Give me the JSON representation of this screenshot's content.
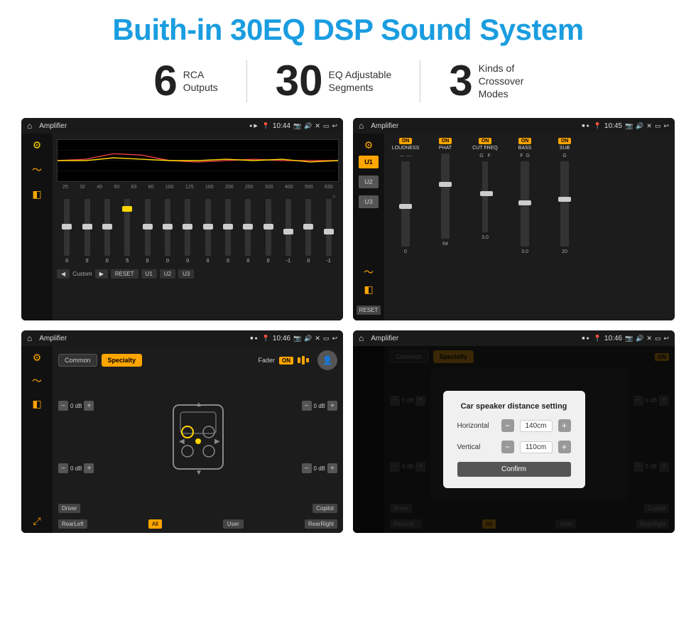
{
  "title": "Buith-in 30EQ DSP Sound System",
  "stats": [
    {
      "number": "6",
      "label": "RCA\nOutputs"
    },
    {
      "number": "30",
      "label": "EQ Adjustable\nSegments"
    },
    {
      "number": "3",
      "label": "Kinds of\nCrossover Modes"
    }
  ],
  "screens": [
    {
      "id": "screen1",
      "status": {
        "time": "10:44",
        "title": "Amplifier"
      },
      "eq_labels": [
        "25",
        "32",
        "40",
        "50",
        "63",
        "80",
        "100",
        "125",
        "160",
        "200",
        "250",
        "320",
        "400",
        "500",
        "630"
      ],
      "eq_values": [
        "0",
        "0",
        "0",
        "5",
        "0",
        "0",
        "0",
        "0",
        "0",
        "0",
        "0",
        "-1",
        "0",
        "-1"
      ],
      "bottom_buttons": [
        "◀",
        "Custom",
        "▶",
        "RESET",
        "U1",
        "U2",
        "U3"
      ]
    },
    {
      "id": "screen2",
      "status": {
        "time": "10:45",
        "title": "Amplifier"
      },
      "presets": [
        "U1",
        "U2",
        "U3"
      ],
      "channels": [
        {
          "name": "LOUDNESS",
          "on": true
        },
        {
          "name": "PHAT",
          "on": true
        },
        {
          "name": "CUT FREQ",
          "on": true
        },
        {
          "name": "BASS",
          "on": true
        },
        {
          "name": "SUB",
          "on": true
        }
      ],
      "reset": "RESET"
    },
    {
      "id": "screen3",
      "status": {
        "time": "10:46",
        "title": "Amplifier"
      },
      "tabs": [
        "Common",
        "Specialty"
      ],
      "active_tab": "Specialty",
      "fader_label": "Fader",
      "on_label": "ON",
      "labels": {
        "driver": "Driver",
        "copilot": "Copilot",
        "rearleft": "RearLeft",
        "all": "All",
        "user": "User",
        "rearright": "RearRight"
      },
      "db_values": [
        "0 dB",
        "0 dB",
        "0 dB",
        "0 dB"
      ]
    },
    {
      "id": "screen4",
      "status": {
        "time": "10:46",
        "title": "Amplifier"
      },
      "modal": {
        "title": "Car speaker distance setting",
        "rows": [
          {
            "label": "Horizontal",
            "value": "140cm"
          },
          {
            "label": "Vertical",
            "value": "110cm"
          }
        ],
        "confirm": "Confirm"
      },
      "tabs": [
        "Common",
        "Specialty"
      ],
      "labels": {
        "driver": "Driver",
        "rearleft": "RearLef...",
        "all": "All",
        "user": "User",
        "rearright": "RearRight"
      }
    }
  ]
}
